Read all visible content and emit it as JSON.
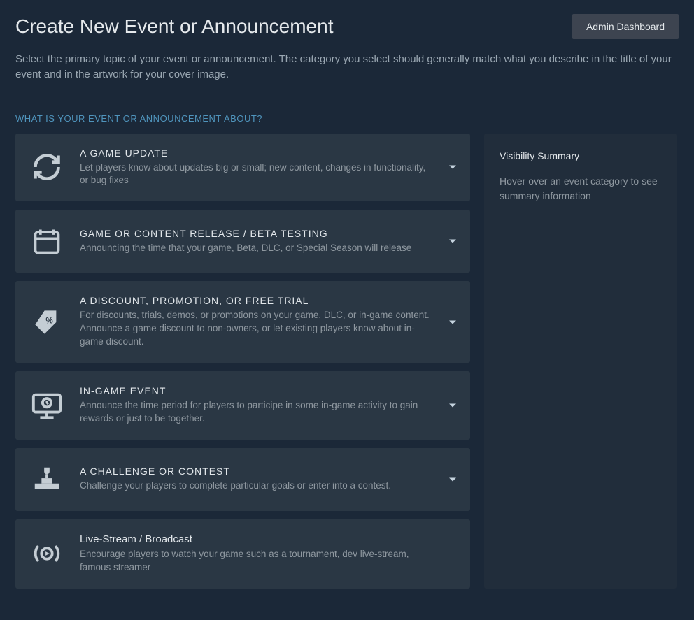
{
  "header": {
    "title": "Create New Event or Announcement",
    "adminButton": "Admin Dashboard",
    "description": "Select the primary topic of your event or announcement. The category you select should generally match what you describe in the title of your event and in the artwork for your cover image."
  },
  "sectionLabel": "WHAT IS YOUR EVENT OR ANNOUNCEMENT ABOUT?",
  "categories": [
    {
      "title": "A GAME UPDATE",
      "desc": "Let players know about updates big or small; new content, changes in functionality, or bug fixes"
    },
    {
      "title": "GAME OR CONTENT RELEASE / BETA TESTING",
      "desc": "Announcing the time that your game, Beta, DLC, or Special Season will release"
    },
    {
      "title": "A DISCOUNT, PROMOTION, OR FREE TRIAL",
      "desc": "For discounts, trials, demos, or promotions on your game, DLC, or in-game content. Announce a game discount to non-owners, or let existing players know about in-game discount."
    },
    {
      "title": "IN-GAME EVENT",
      "desc": "Announce the time period for players to participe in some in-game activity to gain rewards or just to be together."
    },
    {
      "title": "A CHALLENGE OR CONTEST",
      "desc": "Challenge your players to complete particular goals or enter into a contest."
    },
    {
      "title": "Live-Stream / Broadcast",
      "desc": "Encourage players to watch your game such as a tournament, dev live-stream, famous streamer"
    }
  ],
  "sidebar": {
    "title": "Visibility Summary",
    "desc": "Hover over an event category to see summary information"
  }
}
